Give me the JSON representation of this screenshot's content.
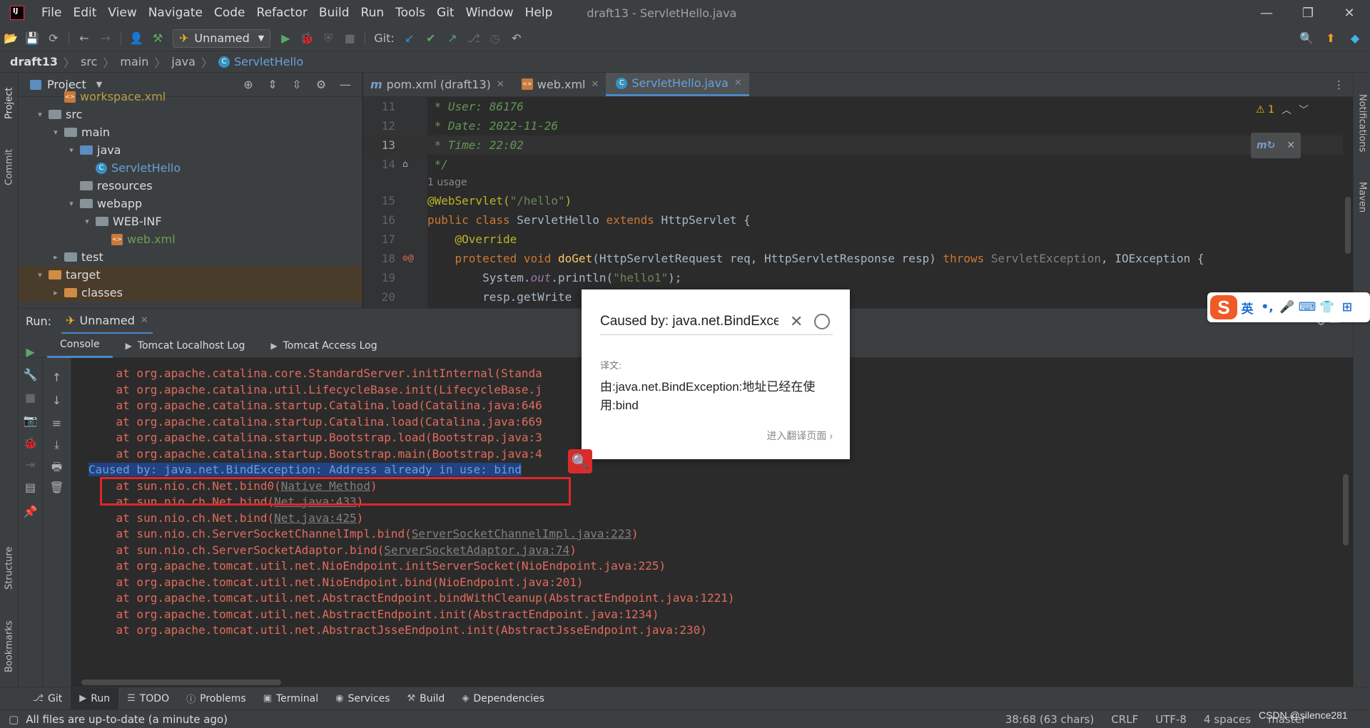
{
  "window": {
    "title": "draft13 - ServletHello.java",
    "menu": [
      "File",
      "Edit",
      "View",
      "Navigate",
      "Code",
      "Refactor",
      "Build",
      "Run",
      "Tools",
      "Git",
      "Window",
      "Help"
    ],
    "controls": [
      "—",
      "❐",
      "✕"
    ]
  },
  "toolbar": {
    "run_config": "Unnamed",
    "git_label": "Git:"
  },
  "breadcrumb": {
    "items": [
      "draft13",
      "src",
      "main",
      "java",
      "ServletHello"
    ]
  },
  "left_stripe": {
    "project": "Project",
    "commit": "Commit",
    "structure": "Structure",
    "bookmarks": "Bookmarks"
  },
  "right_stripe": {
    "notifications": "Notifications",
    "maven": "Maven"
  },
  "project_panel": {
    "title": "Project",
    "tree": [
      {
        "label": "workspace.xml",
        "depth": 2,
        "kind": "xml-yellow"
      },
      {
        "label": "src",
        "depth": 1,
        "kind": "folder",
        "arrow": "▾"
      },
      {
        "label": "main",
        "depth": 2,
        "kind": "folder",
        "arrow": "▾"
      },
      {
        "label": "java",
        "depth": 3,
        "kind": "folder-blue",
        "arrow": "▾"
      },
      {
        "label": "ServletHello",
        "depth": 4,
        "kind": "class"
      },
      {
        "label": "resources",
        "depth": 3,
        "kind": "folder-gray"
      },
      {
        "label": "webapp",
        "depth": 3,
        "kind": "folder",
        "arrow": "▾"
      },
      {
        "label": "WEB-INF",
        "depth": 4,
        "kind": "folder",
        "arrow": "▾"
      },
      {
        "label": "web.xml",
        "depth": 5,
        "kind": "xml"
      },
      {
        "label": "test",
        "depth": 2,
        "kind": "folder",
        "arrow": "▸"
      },
      {
        "label": "target",
        "depth": 1,
        "kind": "folder-orange",
        "arrow": "▾"
      },
      {
        "label": "classes",
        "depth": 2,
        "kind": "folder-orange",
        "arrow": "▸"
      }
    ]
  },
  "editor": {
    "tabs": [
      {
        "label": "pom.xml (draft13)",
        "active": false
      },
      {
        "label": "web.xml",
        "active": false
      },
      {
        "label": "ServletHello.java",
        "active": true
      }
    ],
    "warning_count": "⚠ 1",
    "usage_hint": "1 usage",
    "lines": {
      "l11": {
        "num": "11",
        "text": " * User: 86176"
      },
      "l12": {
        "num": "12",
        "text": " * Date: 2022-11-26"
      },
      "l13": {
        "num": "13",
        "text": " * Time: 22:02"
      },
      "l14": {
        "num": "14",
        "text": " */"
      },
      "l15": {
        "num": "15",
        "ann": "@WebServlet(",
        "str": "\"/hello\"",
        "rest": ")"
      },
      "l16": {
        "num": "16",
        "kw1": "public class ",
        "name": "ServletHello ",
        "kw2": "extends ",
        "rest": "HttpServlet {"
      },
      "l17": {
        "num": "17",
        "ann": "    @Override"
      },
      "l18": {
        "num": "18",
        "kw1": "    protected void ",
        "fn": "doGet",
        "rest": "(HttpServletRequest req, HttpServletResponse resp) ",
        "kw2": "throws ",
        "exc": "ServletException",
        "rest2": ", IOException {"
      },
      "l19": {
        "num": "19",
        "pre": "        System.",
        "out": "out",
        "post": ".println(",
        "str": "\"hello1\"",
        "end": ");"
      },
      "l20": {
        "num": "20",
        "text": "        resp.getWrite"
      }
    }
  },
  "run_panel": {
    "label": "Run:",
    "tab": "Unnamed",
    "console_tabs": [
      "Console",
      "Tomcat Localhost Log",
      "Tomcat Access Log"
    ],
    "console_lines": [
      {
        "text": "    at org.apache.catalina.core.StandardServer.initInternal(Standa"
      },
      {
        "text": "    at org.apache.catalina.util.LifecycleBase.init(LifecycleBase.j"
      },
      {
        "text": "    at org.apache.catalina.startup.Catalina.load(Catalina.java:646"
      },
      {
        "text": "    at org.apache.catalina.startup.Catalina.load(Catalina.java:669"
      },
      {
        "text": "    at org.apache.catalina.startup.Bootstrap.load(Bootstrap.java:3"
      },
      {
        "text": "    at org.apache.catalina.startup.Bootstrap.main(Bootstrap.java:4"
      },
      {
        "text": "Caused by: java.net.BindException: Address already in use: bind",
        "highlight": true
      },
      {
        "text": "    at sun.nio.ch.Net.bind0(",
        "link": "Native Method",
        "after": ")"
      },
      {
        "text": "    at sun.nio.ch.Net.bind(",
        "link": "Net.java:433",
        "after": ")"
      },
      {
        "text": "    at sun.nio.ch.Net.bind(",
        "link": "Net.java:425",
        "after": ")"
      },
      {
        "text": "    at sun.nio.ch.ServerSocketChannelImpl.bind(",
        "link": "ServerSocketChannelImpl.java:223",
        "after": ")"
      },
      {
        "text": "    at sun.nio.ch.ServerSocketAdaptor.bind(",
        "link": "ServerSocketAdaptor.java:74",
        "after": ")"
      },
      {
        "text": "    at org.apache.tomcat.util.net.NioEndpoint.initServerSocket(NioEndpoint.java:225)"
      },
      {
        "text": "    at org.apache.tomcat.util.net.NioEndpoint.bind(NioEndpoint.java:201)"
      },
      {
        "text": "    at org.apache.tomcat.util.net.AbstractEndpoint.bindWithCleanup(AbstractEndpoint.java:1221)"
      },
      {
        "text": "    at org.apache.tomcat.util.net.AbstractEndpoint.init(AbstractEndpoint.java:1234)"
      },
      {
        "text": "    at org.apache.tomcat.util.net.AbstractJsseEndpoint.init(AbstractJsseEndpoint.java:230)"
      }
    ]
  },
  "bottom_tools": [
    "Git",
    "Run",
    "TODO",
    "Problems",
    "Terminal",
    "Services",
    "Build",
    "Dependencies"
  ],
  "statusbar": {
    "message": "All files are up-to-date (a minute ago)",
    "position": "38:68 (63 chars)",
    "line_sep": "CRLF",
    "encoding": "UTF-8",
    "indent": "4 spaces",
    "branch": "master"
  },
  "watermark": "CSDN @silence281",
  "translation_popup": {
    "query": "Caused by: java.net.BindException: Address already in use: bind",
    "label": "译文:",
    "result": "由:java.net.BindException:地址已经在使用:bind",
    "link": "进入翻译页面 ›"
  },
  "ime_bar": {
    "logo": "S",
    "mode": "英",
    "items": [
      "•,",
      "🎤",
      "⌨",
      "👕",
      "⊞"
    ]
  }
}
